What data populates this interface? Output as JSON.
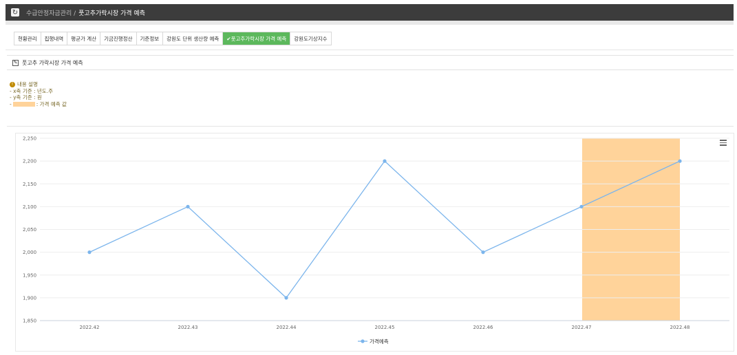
{
  "header": {
    "breadcrumb_parent": "수급안정자금관리 /",
    "breadcrumb_current": "풋고추가락시장 가격 예측"
  },
  "tabs": [
    {
      "label": "현황관리",
      "active": false
    },
    {
      "label": "집행내역",
      "active": false
    },
    {
      "label": "평균가 계산",
      "active": false
    },
    {
      "label": "기금진행정산",
      "active": false
    },
    {
      "label": "기준정보",
      "active": false
    },
    {
      "label": "강원도 단위 생산량 예측",
      "active": false
    },
    {
      "label": "✔풋고추가락시장 가격 예측",
      "active": true
    },
    {
      "label": "강원도기상지수",
      "active": false
    }
  ],
  "panel": {
    "title": "풋고추 가락시장 가격 예측"
  },
  "description": {
    "heading": "내용 설명",
    "line1": "- x축 기준 : 년도.주",
    "line2": "- y축 기준 : 원",
    "line3_prefix": "-",
    "line3_suffix": ": 가격 예측 값"
  },
  "colors": {
    "accent": "#5cb85c",
    "series": "#7cb5ec",
    "forecast_band": "#ffd39a",
    "header_bg": "#3c3c3c"
  },
  "chart_data": {
    "type": "line",
    "categories": [
      "2022.42",
      "2022.43",
      "2022.44",
      "2022.45",
      "2022.46",
      "2022.47",
      "2022.48"
    ],
    "series": [
      {
        "name": "가격예측",
        "values": [
          2000,
          2100,
          1900,
          2200,
          2000,
          2100,
          2200
        ]
      }
    ],
    "ylim": [
      1850,
      2250
    ],
    "yticks": [
      1850,
      1900,
      1950,
      2000,
      2050,
      2100,
      2150,
      2200,
      2250
    ],
    "ytick_labels": [
      "1,850",
      "1,900",
      "1,950",
      "2,000",
      "2,050",
      "2,100",
      "2,150",
      "2,200",
      "2,250"
    ],
    "forecast_band": {
      "from": "2022.47",
      "to": "2022.48"
    },
    "grid": true,
    "legend_position": "bottom"
  }
}
